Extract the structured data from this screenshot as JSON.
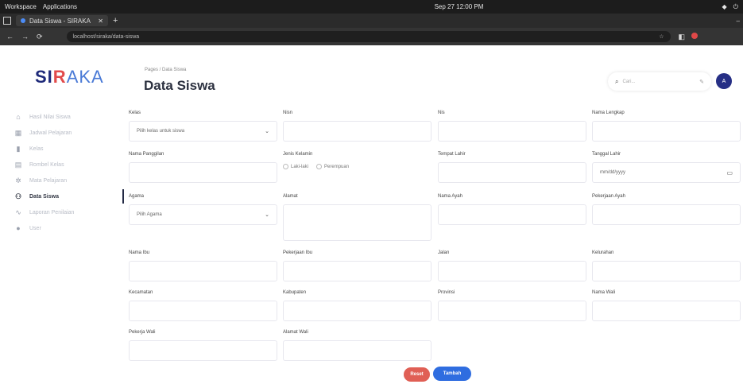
{
  "os": {
    "left_items": [
      "Workspace",
      "Applications"
    ],
    "clock": "Sep 27 12:00 PM",
    "right_items": [
      "wifi",
      "power"
    ]
  },
  "browser": {
    "tab_title": "Data Siswa - SIRAKA",
    "address": "localhost/siraka/data-siswa",
    "new_tab_icon": "+"
  },
  "app": {
    "logo": {
      "part1": "SI",
      "part2": "R",
      "part3": "AKA"
    },
    "sidebar": {
      "items": [
        {
          "label": "Hasil Nilai Siswa",
          "icon": "home-icon"
        },
        {
          "label": "Jadwal Pelajaran",
          "icon": "calendar-icon"
        },
        {
          "label": "Kelas",
          "icon": "book-icon"
        },
        {
          "label": "Rombel Kelas",
          "icon": "layers-icon"
        },
        {
          "label": "Mata Pelajaran",
          "icon": "gear-icon"
        },
        {
          "label": "Data Siswa",
          "icon": "users-icon",
          "active": true
        },
        {
          "label": "Laporan Penilaian",
          "icon": "chart-icon"
        },
        {
          "label": "User",
          "icon": "person-icon"
        }
      ]
    },
    "header": {
      "breadcrumb": "Pages / Data Siswa",
      "title": "Data Siswa",
      "search_placeholder": "Cari...",
      "avatar_initial": "A"
    },
    "form": {
      "kelas": {
        "label": "Kelas",
        "value": "Pilih kelas untuk siswa"
      },
      "nisn": {
        "label": "Nisn",
        "value": ""
      },
      "nis": {
        "label": "Nis",
        "value": ""
      },
      "nama_lengkap": {
        "label": "Nama Lengkap",
        "value": ""
      },
      "nama_panggilan": {
        "label": "Nama Panggilan",
        "value": ""
      },
      "jenis_kelamin": {
        "label": "Jenis Kelamin",
        "options": [
          "Laki-laki",
          "Perempuan"
        ]
      },
      "tempat_lahir": {
        "label": "Tempat Lahir",
        "value": ""
      },
      "tanggal_lahir": {
        "label": "Tanggal Lahir",
        "placeholder": "mm/dd/yyyy"
      },
      "agama": {
        "label": "Agama",
        "value": "Pilih Agama"
      },
      "alamat": {
        "label": "Alamat",
        "value": ""
      },
      "nama_ayah": {
        "label": "Nama Ayah",
        "value": ""
      },
      "pekerjaan_ayah": {
        "label": "Pekerjaan Ayah",
        "value": ""
      },
      "nama_ibu": {
        "label": "Nama Ibu",
        "value": ""
      },
      "pekerjaan_ibu": {
        "label": "Pekerjaan Ibu",
        "value": ""
      },
      "jalan": {
        "label": "Jalan",
        "value": ""
      },
      "kelurahan": {
        "label": "Kelurahan",
        "value": ""
      },
      "kecamatan": {
        "label": "Kecamatan",
        "value": ""
      },
      "kabupaten": {
        "label": "Kabupaten",
        "value": ""
      },
      "provinsi": {
        "label": "Provinsi",
        "value": ""
      },
      "nama_wali": {
        "label": "Nama Wali",
        "value": ""
      },
      "pekerja_wali": {
        "label": "Pekerja Wali",
        "value": ""
      },
      "alamat_wali": {
        "label": "Alamat Wali",
        "value": ""
      }
    },
    "buttons": {
      "reset": "Reset",
      "submit": "Tambah"
    }
  }
}
